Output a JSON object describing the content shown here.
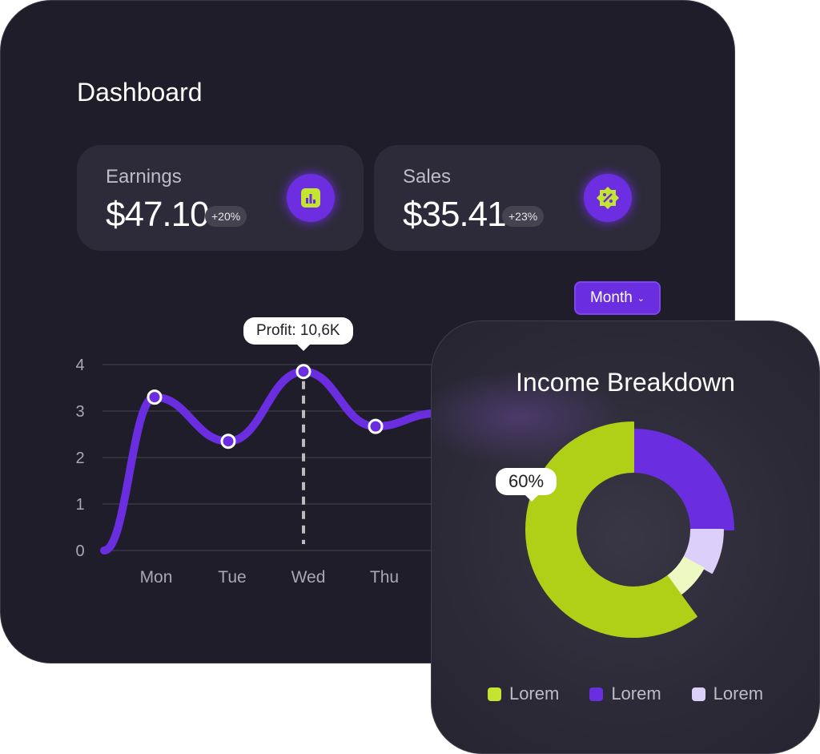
{
  "dashboard": {
    "title": "Dashboard",
    "stats": [
      {
        "label": "Earnings",
        "value": "$47.10",
        "change": "+20%",
        "icon": "bar-chart-icon"
      },
      {
        "label": "Sales",
        "value": "$35.41",
        "change": "+23%",
        "icon": "discount-badge-icon"
      }
    ],
    "period_select": {
      "value": "Month"
    },
    "tooltip": "Profit: 10,6K"
  },
  "income": {
    "title": "Income Breakdown",
    "tooltip": "60%",
    "legend": [
      {
        "label": "Lorem",
        "color": "#c4e530"
      },
      {
        "label": "Lorem",
        "color": "#6a2ee0"
      },
      {
        "label": "Lorem",
        "color": "#dccffa"
      }
    ]
  },
  "colors": {
    "accent": "#6a2ee0",
    "lime": "#afd016"
  },
  "chart_data": [
    {
      "type": "line",
      "categories": [
        "Mon",
        "Tue",
        "Wed",
        "Thu"
      ],
      "series": [
        {
          "values": [
            3.3,
            2.35,
            3.85,
            2.67
          ]
        }
      ],
      "start_value": 0,
      "yticks": [
        "0",
        "1",
        "2",
        "3",
        "4"
      ],
      "ylim": [
        0,
        4
      ],
      "grid": true,
      "highlight": {
        "category": "Wed",
        "label": "Profit: 10,6K"
      }
    },
    {
      "type": "pie",
      "title": "Income Breakdown",
      "slices": [
        {
          "value": 25,
          "color": "#6a2ee0"
        },
        {
          "value": 8,
          "color": "#dccffa"
        },
        {
          "value": 7,
          "color": "#eef8c2"
        },
        {
          "value": 60,
          "color": "#afd016"
        }
      ],
      "annotation": "60%"
    }
  ]
}
